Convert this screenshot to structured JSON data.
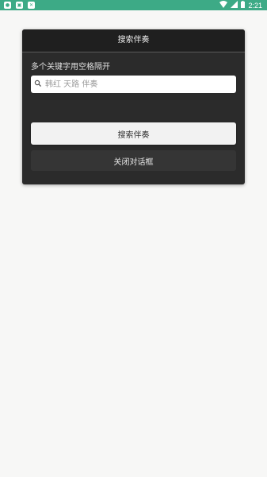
{
  "status_bar": {
    "time": "2:21",
    "left_icons": [
      "notification-icon-1",
      "notification-icon-2",
      "notification-icon-3"
    ],
    "right_icons": [
      "wifi-icon",
      "signal-icon",
      "battery-icon"
    ],
    "color": "#3daa86"
  },
  "dialog": {
    "title": "搜索伴奏",
    "hint": "多个关键字用空格隔开",
    "search": {
      "value": "",
      "placeholder": "韩红 天路 伴奏"
    },
    "search_button_label": "搜索伴奏",
    "close_button_label": "关闭对话框"
  }
}
